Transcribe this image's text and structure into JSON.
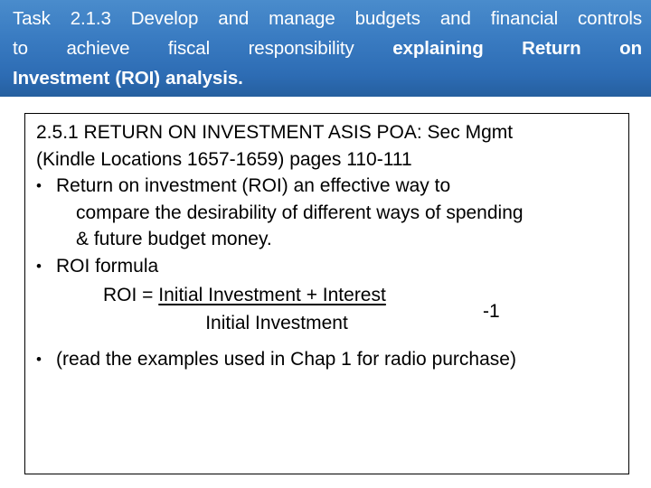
{
  "slide": {
    "header": {
      "line1": "Task 2.1.3 Develop and manage budgets and financial controls",
      "line2_normal": "to achieve fiscal responsibility ",
      "line2_bold": "explaining Return on",
      "line3_bold": "Investment (ROI) analysis.",
      "background_color": "#3a7cc2",
      "text_color": "#ffffff"
    },
    "content": {
      "heading_line1": "2.5.1 RETURN ON INVESTMENT ASIS POA: Sec Mgmt",
      "heading_line2": "(Kindle Locations 1657-1659) pages 110-111",
      "bullet_mark": "•",
      "bullets": [
        {
          "text": "Return on investment (ROI) an effective way to",
          "continuation": [
            "compare the desirability of different ways of spending",
            "& future budget money."
          ]
        },
        {
          "text": "ROI formula",
          "continuation": []
        },
        {
          "text": "(read the examples used  in Chap 1 for radio purchase)",
          "continuation": []
        }
      ],
      "formula": {
        "lhs": "ROI = ",
        "numerator": "Initial Investment + Interest",
        "denominator": "Initial Investment",
        "suffix": "-1"
      },
      "border_color": "#000000",
      "text_color": "#000000"
    }
  }
}
